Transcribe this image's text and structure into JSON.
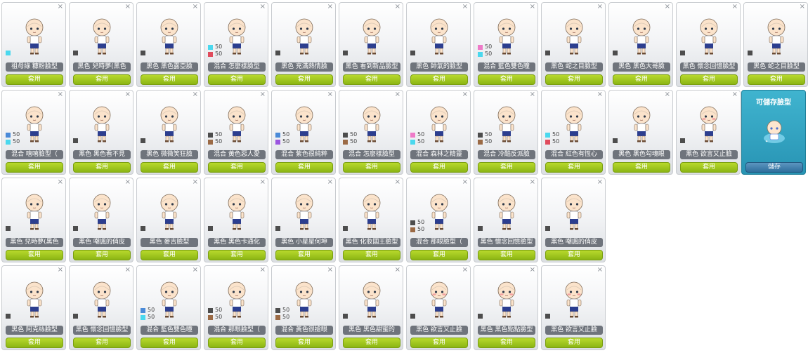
{
  "apply_label": "套用",
  "close_symbol": "×",
  "colors": {
    "black": "#4d4d4d",
    "cyan": "#4ad8ee",
    "red": "#e04b5c",
    "blue": "#4a8ad8",
    "brown": "#9b6a45",
    "purple": "#9b55e0",
    "pink": "#ee7ac8"
  },
  "save_panel": {
    "title": "可儲存臉型",
    "button": "儲存"
  },
  "cards": [
    {
      "name": "祖母綠 糠粉臉型",
      "swatches": [
        {
          "color": "cyan"
        }
      ],
      "face": "plain"
    },
    {
      "name": "黑色 兒時夢(黑色",
      "swatches": [
        {
          "color": "black"
        }
      ],
      "face": "plain"
    },
    {
      "name": "黑色 黑色露亞臉",
      "swatches": [
        {
          "color": "black"
        }
      ],
      "face": "plain"
    },
    {
      "name": "混合 怎麼樣臉型",
      "swatches": [
        {
          "color": "cyan",
          "pct": "50"
        },
        {
          "color": "red",
          "pct": "50"
        }
      ],
      "face": "plain"
    },
    {
      "name": "黑色 充滿熱情臉",
      "swatches": [
        {
          "color": "black"
        }
      ],
      "face": "plain"
    },
    {
      "name": "黑色 看到新品臉型",
      "swatches": [
        {
          "color": "black"
        }
      ],
      "face": "plain"
    },
    {
      "name": "黑色 帥氣的臉型",
      "swatches": [
        {
          "color": "black"
        }
      ],
      "face": "plain"
    },
    {
      "name": "混合 藍色雙色瞳",
      "swatches": [
        {
          "color": "pink",
          "pct": "50"
        },
        {
          "color": "cyan",
          "pct": "50"
        }
      ],
      "face": "plain"
    },
    {
      "name": "黑色 蛇之目臉型",
      "swatches": [
        {
          "color": "black"
        }
      ],
      "face": "plain"
    },
    {
      "name": "黑色 黑色大哥臉",
      "swatches": [
        {
          "color": "black"
        }
      ],
      "face": "plain"
    },
    {
      "name": "黑色 懷念回憶臉型",
      "swatches": [
        {
          "color": "black"
        }
      ],
      "face": "plain"
    },
    {
      "name": "黑色 蛇之目臉型",
      "swatches": [
        {
          "color": "black"
        }
      ],
      "face": "plain"
    },
    {
      "name": "混合 嘻嘻臉型（",
      "swatches": [
        {
          "color": "blue",
          "pct": "50"
        },
        {
          "color": "cyan",
          "pct": "50"
        }
      ],
      "face": "plain"
    },
    {
      "name": "黑色 黑色看不見",
      "swatches": [
        {
          "color": "black"
        }
      ],
      "face": "plain"
    },
    {
      "name": "黑色 微微笑狂臉",
      "swatches": [
        {
          "color": "black"
        }
      ],
      "face": "plain"
    },
    {
      "name": "混合 黃色惡人愛",
      "swatches": [
        {
          "color": "black",
          "pct": "50"
        },
        {
          "color": "brown",
          "pct": "50"
        }
      ],
      "face": "plain"
    },
    {
      "name": "混合 紫色很純粹",
      "swatches": [
        {
          "color": "blue",
          "pct": "50"
        },
        {
          "color": "purple",
          "pct": "50"
        }
      ],
      "face": "plain"
    },
    {
      "name": "混合 怎麼樣臉型",
      "swatches": [
        {
          "color": "black",
          "pct": "50"
        },
        {
          "color": "brown",
          "pct": "50"
        }
      ],
      "face": "plain"
    },
    {
      "name": "混合 森林之精靈",
      "swatches": [
        {
          "color": "pink",
          "pct": "50"
        },
        {
          "color": "cyan",
          "pct": "50"
        }
      ],
      "face": "plain"
    },
    {
      "name": "混合 冷酷反派臉",
      "swatches": [
        {
          "color": "black",
          "pct": "50"
        },
        {
          "color": "brown",
          "pct": "50"
        }
      ],
      "face": "plain"
    },
    {
      "name": "混合 紅色有恆心",
      "swatches": [
        {
          "color": "cyan",
          "pct": "50"
        },
        {
          "color": "red",
          "pct": "50"
        }
      ],
      "face": "plain"
    },
    {
      "name": "黑色 黑色勾魂眼",
      "swatches": [
        {
          "color": "black"
        }
      ],
      "face": "plain"
    },
    {
      "name": "黑色 欲言又止臉",
      "swatches": [
        {
          "color": "black"
        }
      ],
      "face": "blush"
    },
    {
      "name": "黑色 兒時夢(黑色",
      "swatches": [
        {
          "color": "black"
        }
      ],
      "face": "plain"
    },
    {
      "name": "黑色 嘲諷的俏皮",
      "swatches": [
        {
          "color": "black"
        }
      ],
      "face": "plain"
    },
    {
      "name": "黑色 麥吉臉型",
      "swatches": [
        {
          "color": "black"
        }
      ],
      "face": "plain"
    },
    {
      "name": "黑色 黑色卡通化",
      "swatches": [
        {
          "color": "black"
        }
      ],
      "face": "plain"
    },
    {
      "name": "黑色 小星星何坤",
      "swatches": [
        {
          "color": "black"
        }
      ],
      "face": "plain"
    },
    {
      "name": "黑色 化妝國王臉型",
      "swatches": [
        {
          "color": "black"
        }
      ],
      "face": "plain"
    },
    {
      "name": "混合 那眼臉型（",
      "swatches": [
        {
          "color": "black",
          "pct": "50"
        },
        {
          "color": "brown",
          "pct": "50"
        }
      ],
      "face": "plain"
    },
    {
      "name": "黑色 懷念回憶臉型",
      "swatches": [
        {
          "color": "black"
        }
      ],
      "face": "plain"
    },
    {
      "name": "黑色 嘲諷的俏皮",
      "swatches": [
        {
          "color": "black"
        }
      ],
      "face": "plain"
    },
    {
      "name": "黑色 阿克絲臉型",
      "swatches": [
        {
          "color": "black"
        }
      ],
      "face": "plain"
    },
    {
      "name": "黑色 懷念回憶臉型",
      "swatches": [
        {
          "color": "black"
        }
      ],
      "face": "plain"
    },
    {
      "name": "混合 藍色雙色瞳",
      "swatches": [
        {
          "color": "blue",
          "pct": "50"
        },
        {
          "color": "cyan",
          "pct": "50"
        }
      ],
      "face": "plain"
    },
    {
      "name": "混合 那眼臉型（",
      "swatches": [
        {
          "color": "black",
          "pct": "50"
        },
        {
          "color": "brown",
          "pct": "50"
        }
      ],
      "face": "plain"
    },
    {
      "name": "混合 黃色很搶眼",
      "swatches": [
        {
          "color": "black",
          "pct": "50"
        },
        {
          "color": "brown",
          "pct": "50"
        }
      ],
      "face": "plain"
    },
    {
      "name": "黑色 黑色甜蜜的",
      "swatches": [
        {
          "color": "black"
        }
      ],
      "face": "plain"
    },
    {
      "name": "黑色 欲言又止臉",
      "swatches": [
        {
          "color": "black"
        }
      ],
      "face": "blush"
    },
    {
      "name": "黑色 黑色點點臉型",
      "swatches": [
        {
          "color": "black"
        }
      ],
      "face": "blush"
    },
    {
      "name": "黑色 欲言又止臉",
      "swatches": [
        {
          "color": "black"
        }
      ],
      "face": "blush"
    }
  ]
}
